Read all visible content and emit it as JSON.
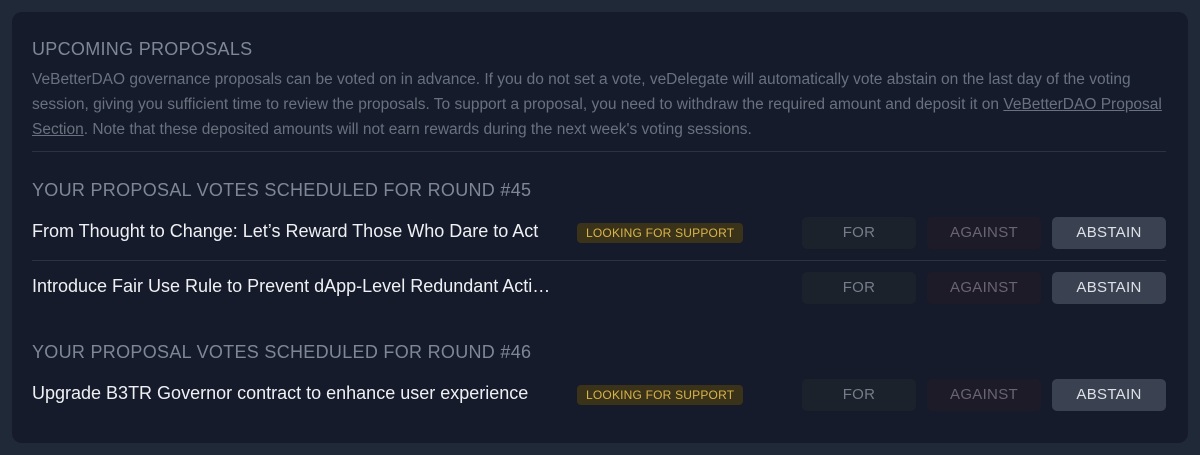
{
  "upcoming": {
    "title": "UPCOMING PROPOSALS",
    "intro_before": "VeBetterDAO governance proposals can be voted on in advance. If you do not set a vote, veDelegate will automatically vote abstain on the last day of the voting session, giving you sufficient time to review the proposals. To support a proposal, you need to withdraw the required amount and deposit it on ",
    "intro_link": "VeBetterDAO Proposal Section",
    "intro_after": ". Note that these deposited amounts will not earn rewards during the next week's voting sessions."
  },
  "vote_labels": {
    "for": "FOR",
    "against": "AGAINST",
    "abstain": "ABSTAIN"
  },
  "selected_vote": "abstain",
  "colors": {
    "background": "#1f2938",
    "panel": "#151b2b",
    "badge_text": "#d9b44a",
    "badge_bg": "#3a3319",
    "selected_button": "#3a4150"
  },
  "rounds": [
    {
      "heading": "YOUR PROPOSAL VOTES SCHEDULED FOR ROUND #45",
      "proposals": [
        {
          "title": "From Thought to Change: Let’s Reward Those Who Dare to Act",
          "badge": "LOOKING FOR SUPPORT"
        },
        {
          "title": "Introduce Fair Use Rule to Prevent dApp-Level Redundant Actions",
          "badge": ""
        }
      ]
    },
    {
      "heading": "YOUR PROPOSAL VOTES SCHEDULED FOR ROUND #46",
      "proposals": [
        {
          "title": "Upgrade B3TR Governor contract to enhance user experience",
          "badge": "LOOKING FOR SUPPORT"
        }
      ]
    }
  ]
}
